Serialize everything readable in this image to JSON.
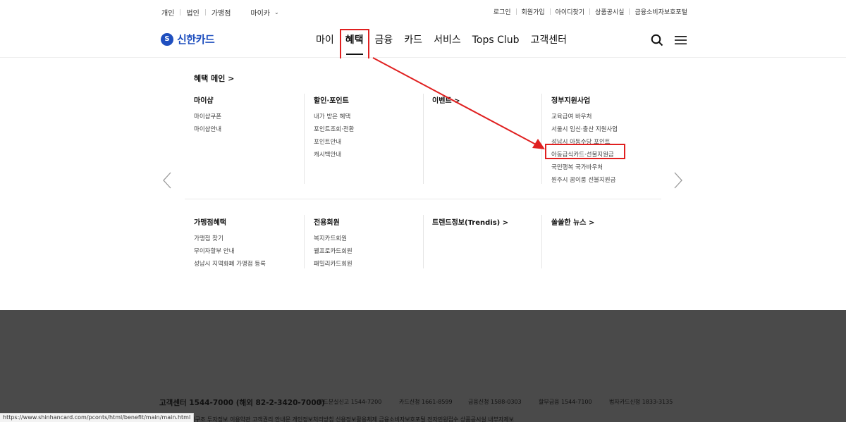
{
  "util": {
    "left": [
      "개인",
      "법인",
      "가맹점"
    ],
    "mycard": "마이카",
    "right": [
      "로그인",
      "회원가입",
      "아이디찾기",
      "상품공시실",
      "금융소비자보호포털"
    ]
  },
  "logo": {
    "text": "신한카드"
  },
  "gnb": {
    "items": [
      "마이",
      "혜택",
      "금융",
      "카드",
      "서비스",
      "Tops Club",
      "고객센터"
    ],
    "active_index": 1
  },
  "mega": {
    "title": "혜택 메인 >",
    "row1": [
      {
        "heading": "마이샵",
        "items": [
          "마이샵쿠폰",
          "마이샵안내"
        ]
      },
      {
        "heading": "할인·포인트",
        "items": [
          "내가 받은 혜택",
          "포인트조회·전환",
          "포인트안내",
          "캐시백안내"
        ]
      },
      {
        "heading": "이벤트 >",
        "items": []
      },
      {
        "heading": "정부지원사업",
        "items": [
          "교육급여 바우처",
          "서울시 임신·출산 지원사업",
          "성남시 아동수당 포인트",
          "아동급식카드·선불지원금",
          "국민행복 국가바우처",
          "원주시 꿈이룸 선불지원금"
        ]
      }
    ],
    "row2": [
      {
        "heading": "가맹점혜택",
        "items": [
          "가맹점 찾기",
          "무이자할부 안내",
          "성남시 지역화폐 가맹점 등록"
        ]
      },
      {
        "heading": "전용회원",
        "items": [
          "복지카드회원",
          "웰프로카드회원",
          "패밀리카드회원"
        ]
      },
      {
        "heading": "트렌드정보(Trendis) >",
        "items": []
      },
      {
        "heading": "쏠쏠한 뉴스 >",
        "items": []
      }
    ]
  },
  "footer": {
    "cs": "고객센터 1544-7000 (해외 82-2-3420-7000)",
    "phones": [
      "카드분실신고 1544-7200",
      "카드신청 1661-8599",
      "금융신청 1588-0303",
      "할부금융 1544-7100",
      "법자카드신청 1833-3135"
    ],
    "links": "지배구조    투자정보    이용약관    고객권리 안내문    개인정보처리방침    신용정보활용체제    금융소비자보호포털    전자민원접수    상품공시실    내부자제보"
  },
  "statusbar": "https://www.shinhancard.com/pconts/html/benefit/main/main.html",
  "colors": {
    "brand": "#1f4fbf",
    "annotation": "#e02020",
    "footer_bg": "#4a4a4a"
  }
}
